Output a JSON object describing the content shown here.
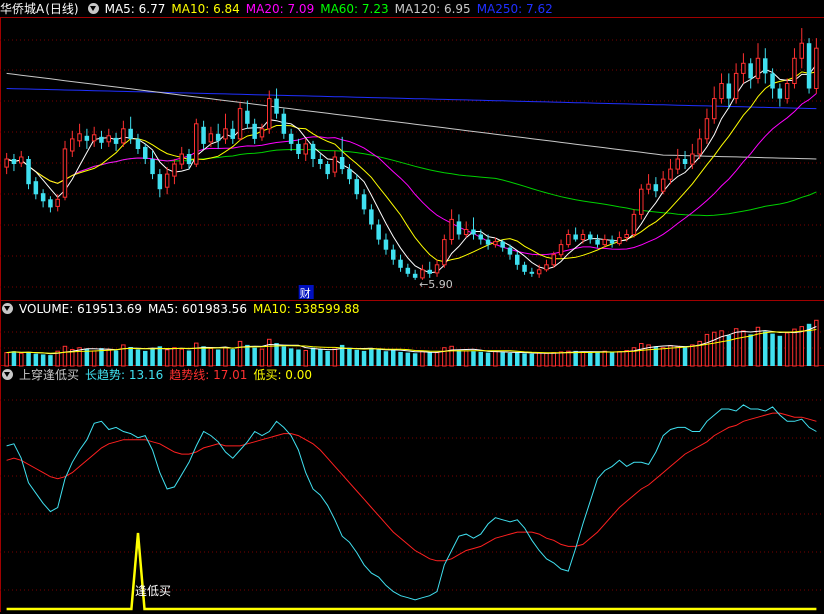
{
  "header_price": {
    "stock_name": "华侨城A",
    "period": "(日线)",
    "ma_items": [
      {
        "label": "MA5: 6.77",
        "color": "#ffffff"
      },
      {
        "label": "MA10: 6.84",
        "color": "#ffff00"
      },
      {
        "label": "MA20: 7.09",
        "color": "#ff00ff"
      },
      {
        "label": "MA60: 7.23",
        "color": "#00ff00"
      },
      {
        "label": "MA120: 6.95",
        "color": "#c8c8c8"
      },
      {
        "label": "MA250: 7.62",
        "color": "#2030ff"
      }
    ]
  },
  "header_volume": {
    "items": [
      {
        "label": "VOLUME: 619513.69",
        "color": "#ffffff"
      },
      {
        "label": "MA5: 601983.56",
        "color": "#ffffff"
      },
      {
        "label": "MA10: 538599.88",
        "color": "#ffff00"
      }
    ]
  },
  "header_indicator": {
    "name": "上穿逢低买",
    "items": [
      {
        "label": "长趋势: 13.16",
        "color": "#40e0f0",
        "label_color": "#40e0f0"
      },
      {
        "label": "趋势线: 17.01",
        "color": "#ff3030",
        "label_color": "#ff3030"
      },
      {
        "label": "低买: 0.00",
        "color": "#ffff00",
        "label_color": "#ffff00"
      }
    ]
  },
  "annotations": {
    "low_price_label": "←5.90",
    "finance_marker": "财",
    "buy_signal_label": "逢低买"
  },
  "colors": {
    "up": "#ff3030",
    "down": "#40e0f0",
    "grid": "#7a0000",
    "ma5": "#ffffff",
    "ma10": "#ffff00",
    "ma20": "#ff00ff",
    "ma60": "#00d000",
    "ma120": "#c8c8c8",
    "ma250": "#2030ff",
    "long_trend": "#40e0f0",
    "trend_line": "#ff2020",
    "buy_signal": "#ffff00"
  },
  "chart_data": [
    {
      "type": "candlestick",
      "title": "华侨城A (日线)",
      "ylim": [
        5.7,
        8.5
      ],
      "candles": [
        [
          7.02,
          7.1,
          7.16,
          6.95
        ],
        [
          7.1,
          7.05,
          7.15,
          6.98
        ],
        [
          7.06,
          7.12,
          7.18,
          7.02
        ],
        [
          7.1,
          6.85,
          7.13,
          6.8
        ],
        [
          6.88,
          6.75,
          6.92,
          6.7
        ],
        [
          6.76,
          6.68,
          6.8,
          6.62
        ],
        [
          6.7,
          6.62,
          6.73,
          6.57
        ],
        [
          6.63,
          6.7,
          6.75,
          6.58
        ],
        [
          6.72,
          7.2,
          7.28,
          6.69
        ],
        [
          7.18,
          7.3,
          7.38,
          7.12
        ],
        [
          7.28,
          7.35,
          7.45,
          7.22
        ],
        [
          7.33,
          7.28,
          7.4,
          7.2
        ],
        [
          7.28,
          7.34,
          7.42,
          7.22
        ],
        [
          7.32,
          7.26,
          7.38,
          7.2
        ],
        [
          7.27,
          7.33,
          7.4,
          7.22
        ],
        [
          7.31,
          7.25,
          7.36,
          7.18
        ],
        [
          7.26,
          7.4,
          7.48,
          7.22
        ],
        [
          7.4,
          7.3,
          7.52,
          7.25
        ],
        [
          7.3,
          7.2,
          7.35,
          7.15
        ],
        [
          7.22,
          7.1,
          7.25,
          7.05
        ],
        [
          7.1,
          6.95,
          7.18,
          6.9
        ],
        [
          6.95,
          6.8,
          7.0,
          6.72
        ],
        [
          6.82,
          6.95,
          7.02,
          6.75
        ],
        [
          6.93,
          7.05,
          7.1,
          6.85
        ],
        [
          7.05,
          7.15,
          7.22,
          7.0
        ],
        [
          7.15,
          7.05,
          7.2,
          7.0
        ],
        [
          7.05,
          7.45,
          7.5,
          7.02
        ],
        [
          7.42,
          7.25,
          7.48,
          7.2
        ],
        [
          7.27,
          7.35,
          7.42,
          7.22
        ],
        [
          7.35,
          7.28,
          7.45,
          7.2
        ],
        [
          7.3,
          7.4,
          7.55,
          7.25
        ],
        [
          7.4,
          7.3,
          7.48,
          7.25
        ],
        [
          7.3,
          7.6,
          7.66,
          7.28
        ],
        [
          7.58,
          7.45,
          7.68,
          7.4
        ],
        [
          7.45,
          7.3,
          7.5,
          7.25
        ],
        [
          7.32,
          7.4,
          7.45,
          7.28
        ],
        [
          7.4,
          7.7,
          7.78,
          7.35
        ],
        [
          7.7,
          7.55,
          7.8,
          7.5
        ],
        [
          7.55,
          7.35,
          7.6,
          7.3
        ],
        [
          7.35,
          7.25,
          7.4,
          7.18
        ],
        [
          7.25,
          7.15,
          7.3,
          7.1
        ],
        [
          7.15,
          7.25,
          7.3,
          7.08
        ],
        [
          7.25,
          7.1,
          7.28,
          7.02
        ],
        [
          7.1,
          7.05,
          7.15,
          7.0
        ],
        [
          7.05,
          6.95,
          7.08,
          6.9
        ],
        [
          6.97,
          7.12,
          7.18,
          6.92
        ],
        [
          7.12,
          7.0,
          7.32,
          6.95
        ],
        [
          7.0,
          6.9,
          7.05,
          6.85
        ],
        [
          6.9,
          6.75,
          6.95,
          6.7
        ],
        [
          6.75,
          6.6,
          6.8,
          6.55
        ],
        [
          6.6,
          6.45,
          6.65,
          6.4
        ],
        [
          6.45,
          6.3,
          6.5,
          6.25
        ],
        [
          6.3,
          6.2,
          6.36,
          6.15
        ],
        [
          6.2,
          6.1,
          6.25,
          6.05
        ],
        [
          6.1,
          6.02,
          6.15,
          5.98
        ],
        [
          6.02,
          5.96,
          6.06,
          5.93
        ],
        [
          5.96,
          5.92,
          6.0,
          5.9
        ],
        [
          5.92,
          6.0,
          6.05,
          5.9
        ],
        [
          6.0,
          5.96,
          6.08,
          5.92
        ],
        [
          5.97,
          6.05,
          6.1,
          5.93
        ],
        [
          6.05,
          6.3,
          6.35,
          6.02
        ],
        [
          6.3,
          6.5,
          6.6,
          6.25
        ],
        [
          6.48,
          6.35,
          6.55,
          6.3
        ],
        [
          6.35,
          6.4,
          6.48,
          6.32
        ],
        [
          6.4,
          6.35,
          6.52,
          6.3
        ],
        [
          6.35,
          6.3,
          6.4,
          6.25
        ],
        [
          6.3,
          6.25,
          6.35,
          6.2
        ],
        [
          6.25,
          6.28,
          6.32,
          6.22
        ],
        [
          6.28,
          6.22,
          6.3,
          6.18
        ],
        [
          6.22,
          6.15,
          6.25,
          6.1
        ],
        [
          6.15,
          6.05,
          6.18,
          6.0
        ],
        [
          6.05,
          5.98,
          6.08,
          5.95
        ],
        [
          5.98,
          5.96,
          6.02,
          5.93
        ],
        [
          5.96,
          6.0,
          6.05,
          5.92
        ],
        [
          6.0,
          6.05,
          6.1,
          5.98
        ],
        [
          6.05,
          6.15,
          6.18,
          6.02
        ],
        [
          6.15,
          6.25,
          6.3,
          6.12
        ],
        [
          6.25,
          6.35,
          6.4,
          6.22
        ],
        [
          6.35,
          6.3,
          6.42,
          6.28
        ],
        [
          6.3,
          6.35,
          6.4,
          6.26
        ],
        [
          6.35,
          6.3,
          6.38,
          6.26
        ],
        [
          6.3,
          6.25,
          6.35,
          6.22
        ],
        [
          6.25,
          6.3,
          6.35,
          6.22
        ],
        [
          6.3,
          6.26,
          6.34,
          6.22
        ],
        [
          6.26,
          6.32,
          6.38,
          6.24
        ],
        [
          6.32,
          6.35,
          6.4,
          6.28
        ],
        [
          6.35,
          6.55,
          6.6,
          6.32
        ],
        [
          6.55,
          6.8,
          6.85,
          6.5
        ],
        [
          6.8,
          6.85,
          6.95,
          6.75
        ],
        [
          6.85,
          6.78,
          6.92,
          6.72
        ],
        [
          6.78,
          6.9,
          6.98,
          6.75
        ],
        [
          6.9,
          7.0,
          7.1,
          6.85
        ],
        [
          7.0,
          7.1,
          7.2,
          6.95
        ],
        [
          7.1,
          7.05,
          7.18,
          7.0
        ],
        [
          7.05,
          7.15,
          7.25,
          7.0
        ],
        [
          7.15,
          7.3,
          7.4,
          7.1
        ],
        [
          7.3,
          7.5,
          7.6,
          7.25
        ],
        [
          7.5,
          7.7,
          7.82,
          7.45
        ],
        [
          7.7,
          7.85,
          7.95,
          7.65
        ],
        [
          7.85,
          7.7,
          7.95,
          7.6
        ],
        [
          7.7,
          7.95,
          8.05,
          7.65
        ],
        [
          7.95,
          8.05,
          8.15,
          7.85
        ],
        [
          8.05,
          7.9,
          8.1,
          7.8
        ],
        [
          7.9,
          8.1,
          8.25,
          7.85
        ],
        [
          8.1,
          7.95,
          8.2,
          7.85
        ],
        [
          7.95,
          7.8,
          8.0,
          7.7
        ],
        [
          7.8,
          7.7,
          7.85,
          7.62
        ],
        [
          7.7,
          7.85,
          7.9,
          7.65
        ],
        [
          7.85,
          8.1,
          8.2,
          7.8
        ],
        [
          8.1,
          8.25,
          8.4,
          8.0
        ],
        [
          8.25,
          7.8,
          8.3,
          7.75
        ],
        [
          7.8,
          8.2,
          8.3,
          7.75
        ]
      ],
      "annotations": {
        "low_price": 5.9
      }
    },
    {
      "type": "bar",
      "title": "VOLUME",
      "values": [
        380,
        420,
        360,
        400,
        350,
        330,
        310,
        420,
        560,
        470,
        520,
        480,
        430,
        510,
        460,
        440,
        600,
        540,
        470,
        430,
        500,
        560,
        460,
        520,
        480,
        440,
        650,
        560,
        500,
        470,
        520,
        480,
        700,
        600,
        520,
        480,
        760,
        650,
        560,
        500,
        470,
        440,
        520,
        470,
        430,
        480,
        600,
        520,
        460,
        430,
        500,
        480,
        420,
        460,
        400,
        380,
        360,
        420,
        400,
        380,
        520,
        560,
        450,
        430,
        420,
        400,
        380,
        420,
        390,
        370,
        380,
        360,
        350,
        370,
        360,
        380,
        400,
        420,
        430,
        400,
        380,
        400,
        420,
        390,
        410,
        440,
        520,
        640,
        600,
        560,
        520,
        580,
        560,
        540,
        600,
        700,
        900,
        960,
        1000,
        880,
        1060,
        1000,
        900,
        1100,
        980,
        920,
        860,
        940,
        1050,
        1120,
        1200,
        1300
      ],
      "volume_ma5_value": 601983.56,
      "volume_ma10_value": 538599.88
    },
    {
      "type": "line",
      "title": "上穿逢低买",
      "ylim": [
        0,
        100
      ],
      "series": [
        {
          "name": "长趋势",
          "values": [
            79,
            80,
            73,
            61,
            56,
            51,
            47,
            49,
            63,
            71,
            77,
            82,
            90,
            91,
            87,
            88,
            86,
            85,
            83,
            84,
            77,
            66,
            58,
            59,
            65,
            71,
            79,
            86,
            84,
            81,
            76,
            73,
            77,
            81,
            86,
            84,
            86,
            91,
            88,
            84,
            77,
            66,
            58,
            55,
            50,
            43,
            35,
            32,
            27,
            21,
            17,
            15,
            11,
            8,
            6,
            5,
            4,
            5,
            6,
            8,
            21,
            28,
            35,
            36,
            34,
            36,
            41,
            44,
            43,
            42,
            43,
            39,
            33,
            28,
            24,
            22,
            19,
            18,
            29,
            41,
            52,
            63,
            67,
            69,
            72,
            69,
            71,
            71,
            70,
            76,
            84,
            87,
            88,
            88,
            86,
            86,
            91,
            94,
            97,
            97,
            96,
            99,
            97,
            97,
            96,
            98,
            94,
            91,
            91,
            92,
            88,
            86
          ]
        },
        {
          "name": "趋势线",
          "values": [
            72,
            73,
            72,
            70,
            68,
            66,
            64,
            63,
            64,
            66,
            69,
            72,
            75,
            78,
            80,
            81,
            82,
            82,
            82,
            82,
            81,
            80,
            78,
            76,
            75,
            75,
            76,
            78,
            79,
            80,
            79,
            79,
            79,
            80,
            81,
            82,
            83,
            84,
            85,
            85,
            84,
            82,
            80,
            77,
            73,
            69,
            65,
            61,
            57,
            53,
            49,
            45,
            41,
            37,
            34,
            31,
            28,
            26,
            24,
            23,
            23,
            24,
            26,
            28,
            29,
            30,
            32,
            34,
            35,
            36,
            37,
            37,
            37,
            36,
            34,
            33,
            31,
            30,
            30,
            31,
            34,
            37,
            41,
            45,
            49,
            52,
            55,
            58,
            60,
            63,
            66,
            69,
            72,
            75,
            77,
            79,
            81,
            84,
            86,
            88,
            89,
            91,
            92,
            93,
            94,
            95,
            95,
            94,
            93,
            93,
            92,
            91
          ]
        },
        {
          "name": "低买",
          "values": [
            0,
            0,
            0,
            0,
            0,
            0,
            0,
            0,
            0,
            0,
            0,
            0,
            0,
            0,
            0,
            0,
            0,
            0,
            0,
            0,
            0,
            0,
            0,
            0,
            0,
            0,
            0,
            0,
            0,
            0,
            0,
            0,
            0,
            0,
            0,
            0,
            0,
            0,
            0,
            0,
            0,
            0,
            0,
            0,
            0,
            0,
            0,
            0,
            0,
            0,
            0,
            0,
            0,
            0,
            0,
            0,
            0,
            0,
            0,
            0,
            0,
            0,
            0,
            0,
            0,
            0,
            0,
            0,
            0,
            0,
            0,
            0,
            0,
            0,
            0,
            0,
            0,
            0,
            0,
            0,
            0,
            0,
            0,
            0,
            0,
            0,
            0,
            0,
            0,
            0,
            0,
            0,
            0,
            0,
            0,
            0,
            0,
            0,
            0,
            0,
            0,
            0,
            0,
            0,
            0,
            0,
            0,
            0,
            0,
            0,
            0,
            0
          ]
        }
      ],
      "buy_signal_spike": 18
    }
  ]
}
